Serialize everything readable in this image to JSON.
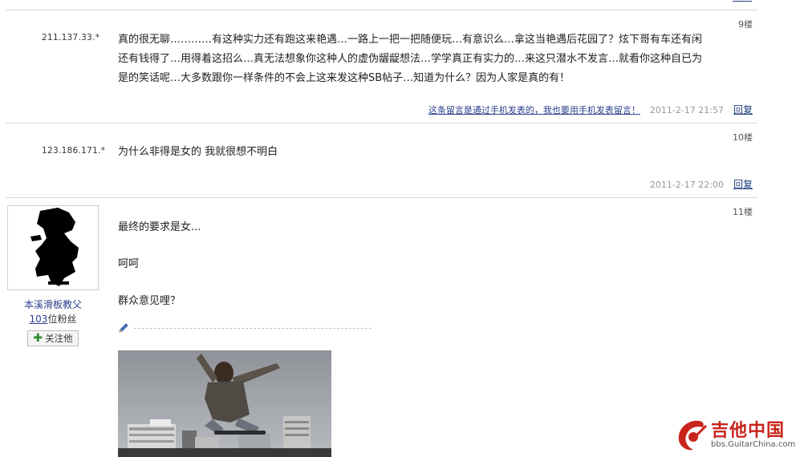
{
  "posts": [
    {
      "floor": "9楼",
      "ip": "211.137.33.*",
      "lines": [
        "真的很无聊…………有这种实力还有跑这来艳遇…一路上一把一把随便玩…有意识么…拿这当艳遇后花园了？炫下哥有车还有闲",
        "还有钱得了…用得着这招么…真无法想象你这种人的虚伪龌龊想法…学学真正有实力的…来这只潜水不发言…就看你这种自已为",
        "是的笑话呢…大多数跟你一样条件的不会上这来发这种SB帖子…知道为什么？因为人家是真的有！"
      ],
      "mobile_note": "这条留言是通过手机发表的，我也要用手机发表留言！",
      "time": "2011-2-17 21:57",
      "reply": "回复"
    },
    {
      "floor": "10楼",
      "ip": "123.186.171.*",
      "lines": [
        "为什么非得是女的 我就很想不明白"
      ],
      "time": "2011-2-17 22:00",
      "reply": "回复"
    },
    {
      "floor": "11楼",
      "username": "本溪滑板教父",
      "fans_count": "103",
      "fans_suffix": "位粉丝",
      "follow_label": "关注他",
      "lines": [
        "最终的要求是女...",
        "呵呵",
        "群众意见哩？"
      ]
    }
  ],
  "watermark": {
    "title": "吉他中国",
    "url": "bbs.GuitarChina.com"
  },
  "colors": {
    "link": "#1f3d7a",
    "divider": "#d8d8d8",
    "watermark_red": "#c9241c"
  }
}
